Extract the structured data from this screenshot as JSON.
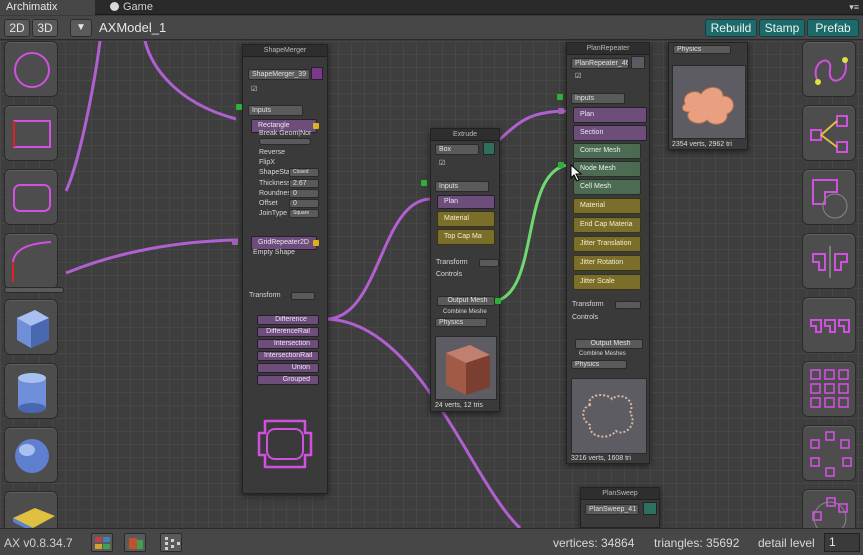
{
  "tabs": [
    {
      "label": "Archimatix",
      "icon": "none"
    },
    {
      "label": "Game",
      "icon": "unity-icon"
    }
  ],
  "toolbar": {
    "btn_2d": "2D",
    "btn_3d": "3D",
    "menu_icon": "triangle-down-icon",
    "model_name": "AXModel_1",
    "rebuild": "Rebuild",
    "stamp": "Stamp",
    "prefab": "Prefab"
  },
  "colors": {
    "accent_teal": "#1e6a6a",
    "wire_purple": "#b060d0",
    "wire_green": "#60d060",
    "node_purple": "#6d4d7a",
    "node_olive": "#7a6e2a",
    "node_green": "#4d6a52"
  },
  "left_palette": [
    "circle-shape-icon",
    "rectangle-shape-icon",
    "rounded-rect-icon",
    "corner-curve-icon",
    "cube-icon",
    "cylinder-icon",
    "sphere-icon",
    "plane-icon"
  ],
  "right_palette": [
    "curve-points-icon",
    "shape-merger-icon",
    "offset-shape-icon",
    "mirror-icon",
    "linear-repeater-icon",
    "grid-repeater-icon",
    "radial-repeater-icon",
    "radial-path-icon"
  ],
  "shape_merger": {
    "title": "ShapeMerger",
    "name": "ShapeMerger_39",
    "inputs": "Inputs",
    "rectangle": "Rectangle",
    "break_geom": "Break Geom|Nor",
    "reverse": "Reverse",
    "flipx": "FlipX",
    "shape_state_label": "ShapeState",
    "shape_state_value": "Closed",
    "thickness_label": "Thickness",
    "thickness_value": "2.67",
    "roundness_label": "Roundness",
    "roundness_value": "0",
    "offset_label": "Offset",
    "offset_value": "0",
    "jointype_label": "JoinType",
    "jointype_value": "Square",
    "grid_repeater": "GridRepeater2D",
    "empty_shape": "Empty Shape",
    "transform": "Transform",
    "outputs": [
      "Difference",
      "DifferenceRail",
      "Intersection",
      "IntersectionRail",
      "Union",
      "Grouped"
    ]
  },
  "extrude": {
    "title": "Extrude",
    "name": "Box",
    "inputs": "Inputs",
    "plan": "Plan",
    "material": "Material",
    "top_cap": "Top Cap Ma",
    "transform": "Transform",
    "controls": "Controls",
    "output_mesh": "Output Mesh",
    "combine": "Combine Meshe",
    "physics": "Physics",
    "stats": "24 verts, 12 tris"
  },
  "plan_repeater": {
    "title": "PlanRepeater",
    "name": "PlanRepeater_46",
    "inputs": "Inputs",
    "plan": "Plan",
    "section": "Section",
    "corner_mesh": "Corner Mesh",
    "node_mesh": "Node Mesh",
    "cell_mesh": "Cell Mesh",
    "material": "Material",
    "end_cap": "End Cap Materia",
    "jitter_translation": "Jitter Translation",
    "jitter_rotation": "Jitter Rotation",
    "jitter_scale": "Jitter Scale",
    "transform": "Transform",
    "controls": "Controls",
    "output_mesh": "Output Mesh",
    "combine": "Combine Meshes",
    "physics": "Physics",
    "stats": "3216 verts, 1608 tri"
  },
  "preview_node": {
    "physics": "Physics",
    "stats": "2354 verts, 2962 tri"
  },
  "plan_sweep": {
    "title": "PlanSweep",
    "name": "PlanSweep_41"
  },
  "status": {
    "version": "AX v0.8.34.7",
    "vertices": "vertices: 34864",
    "triangles": "triangles: 35692",
    "detail_label": "detail level",
    "detail_value": "1"
  }
}
